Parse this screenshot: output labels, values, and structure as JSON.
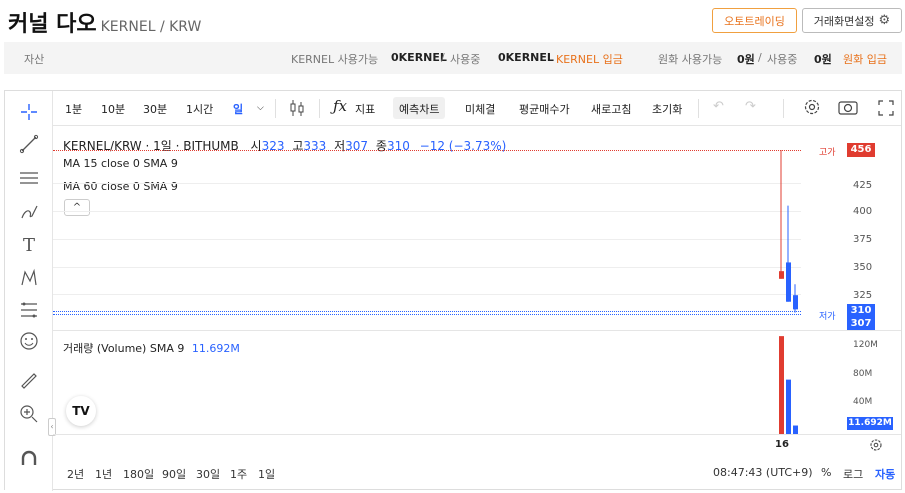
{
  "header": {
    "title": "커널 다오",
    "pair": "KERNEL / KRW",
    "auto_trading": "오토트레이딩",
    "screen_settings": "거래화면설정"
  },
  "assets": {
    "label": "자산",
    "kernel_avail_label": "KERNEL 사용가능",
    "kernel_avail_value": "0KERNEL",
    "kernel_sep": "/",
    "kernel_inuse_label": "사용중",
    "kernel_inuse_value": "0KERNEL",
    "kernel_deposit": "KERNEL 입금",
    "krw_avail_label": "원화 사용가능",
    "krw_avail_value": "0원",
    "krw_sep": "/",
    "krw_inuse_label": "사용중",
    "krw_inuse_value": "0원",
    "krw_deposit": "원화 입금"
  },
  "toolbar": {
    "intervals": [
      "1분",
      "10분",
      "30분",
      "1시간",
      "일"
    ],
    "indicator": "지표",
    "forecast": "예측차트",
    "fine_tune": "미체결",
    "avg_price": "평균매수가",
    "refresh": "새로고침",
    "reset": "초기화"
  },
  "legend": {
    "symbol": "KERNEL/KRW · 1일 · BITHUMB",
    "open_label": "시",
    "open": "323",
    "high_label": "고",
    "high": "333",
    "low_label": "저",
    "low": "307",
    "close_label": "종",
    "close": "310",
    "change": "−12 (−3.73%)",
    "ma15": "MA 15 close 0 SMA 9",
    "ma60": "MA 60 close 0 SMA 9",
    "volume_label": "거래량 (Volume) SMA 9",
    "volume_value": "11.692M",
    "collapse": "^"
  },
  "price_axis": {
    "ticks": [
      "425",
      "400",
      "375",
      "350",
      "325"
    ],
    "high_label": "고가",
    "high_value": "456",
    "low_label": "저가",
    "last_price": "310",
    "low_value": "307"
  },
  "volume_axis": {
    "ticks": [
      "120M",
      "80M",
      "40M"
    ],
    "current": "11.692M"
  },
  "time_axis": {
    "tick": "16"
  },
  "footer": {
    "ranges": [
      "2년",
      "1년",
      "180일",
      "90일",
      "30일",
      "1주",
      "1일"
    ],
    "time": "08:47:43 (UTC+9)",
    "percent": "%",
    "log": "로그",
    "auto": "자동"
  },
  "colors": {
    "up": "#e03c30",
    "down": "#2962ff",
    "accent": "#e8721c"
  },
  "chart_data": {
    "type": "candlestick",
    "candles": [
      {
        "o": 345,
        "h": 456,
        "l": 338,
        "c": 338,
        "dir": "down"
      },
      {
        "o": 353,
        "h": 405,
        "l": 317,
        "c": 317,
        "dir": "down"
      },
      {
        "o": 323,
        "h": 333,
        "l": 307,
        "c": 310,
        "dir": "down"
      }
    ],
    "volumes_M": [
      135,
      75,
      11.692
    ],
    "ylim": [
      300,
      460
    ]
  }
}
